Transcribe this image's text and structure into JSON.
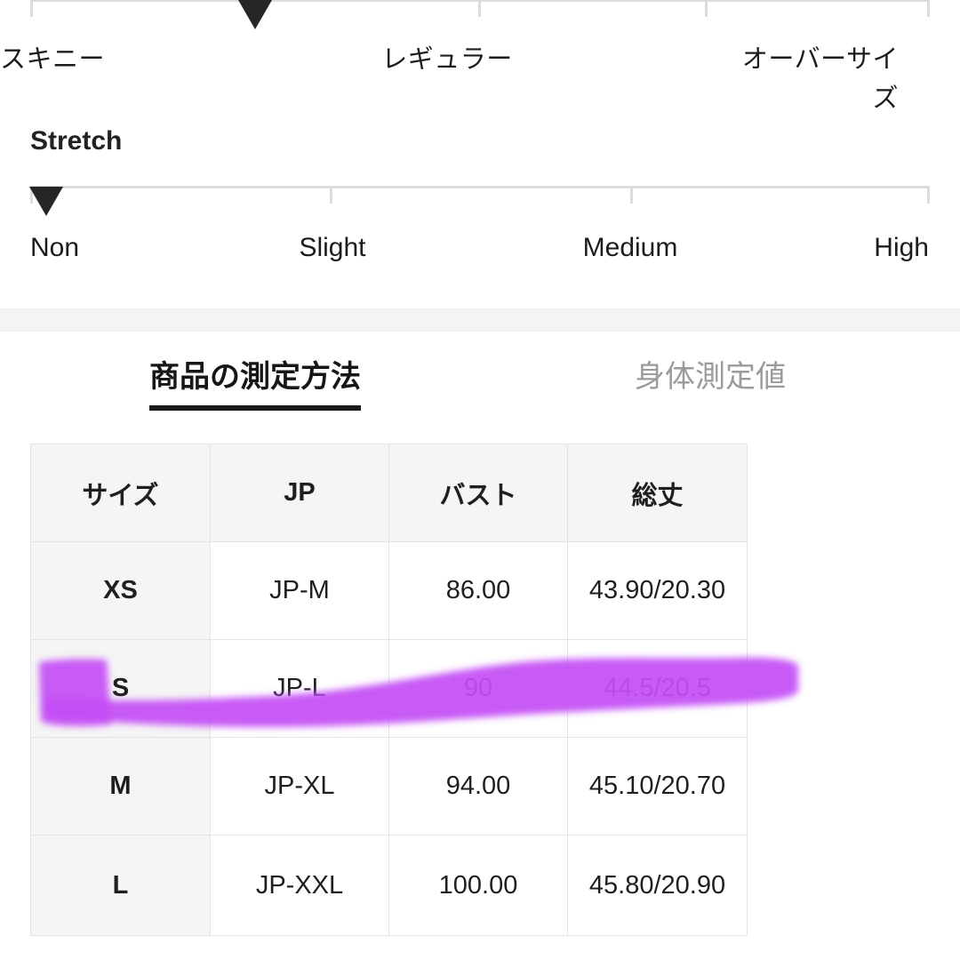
{
  "fit_scale": {
    "name": "fit",
    "labels": [
      "スキニー",
      "レギュラー",
      "オーバーサイズ"
    ],
    "marker_label": "スキニー",
    "tick_count": 4
  },
  "stretch_scale": {
    "title": "Stretch",
    "labels": [
      "Non",
      "Slight",
      "Medium",
      "High"
    ],
    "marker_label": "Non"
  },
  "tabs": [
    {
      "label": "商品の測定方法",
      "active": true
    },
    {
      "label": "身体測定値",
      "active": false
    }
  ],
  "size_table": {
    "headers": [
      "サイズ",
      "JP",
      "バスト",
      "総丈"
    ],
    "rows": [
      {
        "size": "XS",
        "jp": "JP-M",
        "bust": "86.00",
        "length": "43.90/20.30",
        "highlighted": false
      },
      {
        "size": "S",
        "jp": "JP-L",
        "bust": "90",
        "length": "44.5/20.5",
        "highlighted": true
      },
      {
        "size": "M",
        "jp": "JP-XL",
        "bust": "94.00",
        "length": "45.10/20.70",
        "highlighted": false
      },
      {
        "size": "L",
        "jp": "JP-XXL",
        "bust": "100.00",
        "length": "45.80/20.90",
        "highlighted": false
      }
    ]
  },
  "colors": {
    "highlight_marker": "#c44df5",
    "tab_active": "#161616",
    "tab_inactive": "#9b9b9b",
    "rail": "#dcdcdc",
    "marker_triangle": "#262626",
    "header_fill": "#f5f5f5",
    "band": "#f4f4f4"
  },
  "icons": {
    "fit_marker": "triangle-down-marker-icon",
    "stretch_marker": "triangle-down-marker-icon"
  }
}
